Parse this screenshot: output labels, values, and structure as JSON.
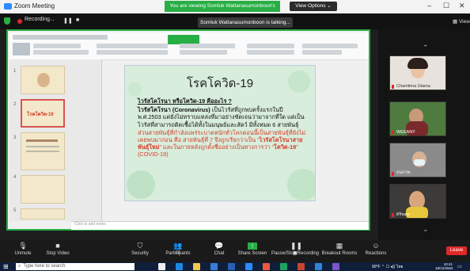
{
  "window": {
    "title": "Zoom Meeting",
    "minimize": "–",
    "maximize": "☐",
    "close": "✕"
  },
  "banner": {
    "text": "You are viewing Somluk Wattanasumonboon's screen",
    "view_options": "View Options ⌄"
  },
  "status": {
    "recording": "Recording...",
    "talking": "Somluk Wattanasumonboon is talking...",
    "view": "View"
  },
  "slide": {
    "title": "โรคโควิด-19",
    "question": "ไวรัสโคโรนา หรือโควิด-19 คืออะไร ?",
    "p1_bold": "ไวรัสโคโรนา (Coronavirus)",
    "p1_rest": " เป็นไวรัสที่ถูกพบครั้งแรกในปี พ.ศ.2503 แต่ยังไม่ทราบแหล่งที่มาอย่างชัดเจนว่ามาจากที่ใด แต่เป็นไวรัสที่สามารถติดเชื้อได้ทั้งในมนุษย์และสัตว์ มีทั้งหมด 6 สายพันธุ์",
    "p2_start": "ส่วนสายพันธุ์ที่กำลังแพร่ระบาดหนักทั่วโลกตอนนี้เป็นสายพันธุ์ที่ยังไม่เคยพบมาก่อน คือ สายพันธุ์ที่ 7 จึงถูกเรียกว่าเป็น “",
    "p2_bold1": "ไวรัสโคโรนาสายพันธุ์ใหม่",
    "p2_mid": "” และในภายหลังถูกตั้งชื่ออย่างเป็นทางการว่า “",
    "p2_bold2": "โควิด-19",
    "p2_end": "” (COVID-19)"
  },
  "notes": {
    "placeholder": "Click to add notes"
  },
  "thumbs": {
    "t1": "1",
    "t2": "2",
    "t3": "3",
    "t4": "4",
    "t5": "5",
    "sel_label": "โรคโควิด-19"
  },
  "participants": [
    {
      "name": "Chamtima Utama"
    },
    {
      "name": "WEEANY"
    },
    {
      "name": "ธนภาพ"
    },
    {
      "name": "iPhone"
    }
  ],
  "toolbar": {
    "unmute": "Unmute",
    "stop_video": "Stop Video",
    "security": "Security",
    "participants": "Participants",
    "participants_count": "61",
    "chat": "Chat",
    "share_screen": "Share Screen",
    "pause_recording": "Pause/Stop Recording",
    "breakout": "Breakout Rooms",
    "reactions": "Reactions",
    "leave": "Leave"
  },
  "taskbar": {
    "search": "Type here to search",
    "weather": "90°F",
    "time": "10:41",
    "date": "18/12/2564",
    "lang": "ไทย"
  },
  "colors": {
    "zoom_green": "#27ae44",
    "leave_red": "#e02828",
    "accent_red": "#d63c28"
  }
}
